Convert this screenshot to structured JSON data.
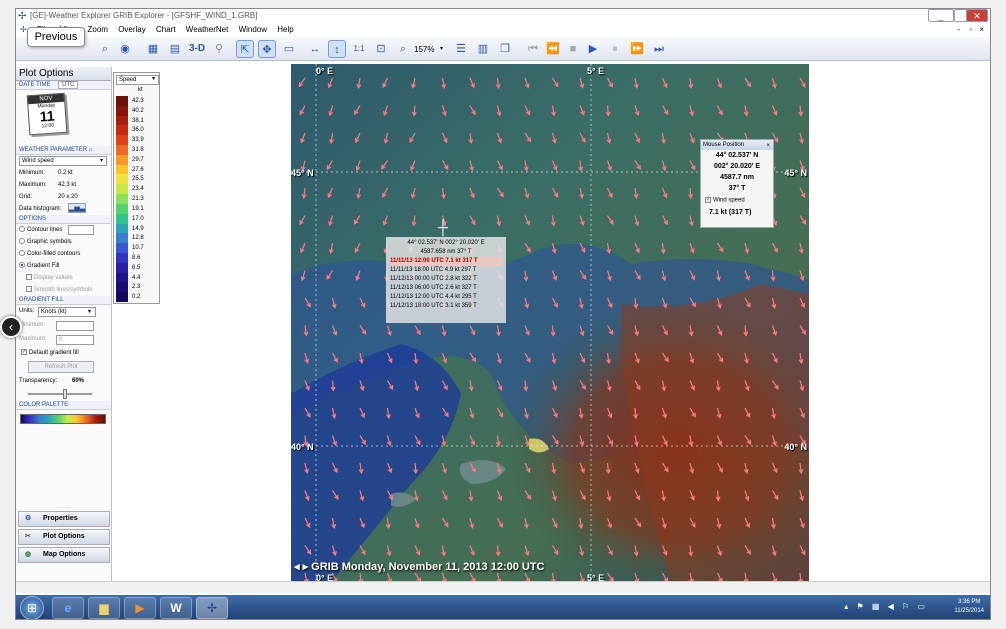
{
  "window": {
    "title": "[GE]-Weather Explorer GRIB Explorer - [GFSHF_WIND_1.GRB]"
  },
  "menu": [
    "File",
    "View",
    "Zoom",
    "Overlay",
    "Chart",
    "WeatherNet",
    "Window",
    "Help"
  ],
  "window_controls": {
    "min": "_",
    "restore": "▫",
    "close": "✕",
    "mdi_min": "-",
    "mdi_restore": "▫",
    "mdi_close": "×"
  },
  "toolbar": {
    "tooltip": "Previous",
    "zoom": "157%",
    "three_d": "3-D"
  },
  "left_panel": {
    "title": "Plot Options",
    "datetime_label": "DATE TIME",
    "utc_label": "UTC",
    "calendar": {
      "month": "NOV",
      "weekday": "Monday",
      "day": "11",
      "time": "12:00"
    },
    "weather_param_label": "WEATHER PARAMETER",
    "param_value": "Wind speed",
    "minimum_label": "Minimum:",
    "minimum": "0.2 kt",
    "maximum_label": "Maximum:",
    "maximum": "42.3 kt",
    "grid_label": "Grid:",
    "grid": "20 x 20",
    "histogram_label": "Data histogram:",
    "options_label": "OPTIONS",
    "options": [
      "Contour lines",
      "Graphic symbols",
      "Color-filled contours",
      "Gradient Fill"
    ],
    "display_values": "Display values",
    "smooth": "Smooth lines/symbols",
    "gradient_label": "GRADIENT FILL",
    "units_label": "Units:",
    "units_value": "Knots (kt)",
    "min_label": "Minimum:",
    "max_label": "Maximum:",
    "max_value": "0",
    "default_fill": "Default gradient fill",
    "refresh": "Refresh Plot",
    "transparency_label": "Transparency:",
    "transparency": "60%",
    "palette_label": "COLOR PALETTE",
    "bottom_buttons": [
      "Properties",
      "Plot Options",
      "Map Options"
    ]
  },
  "legend": {
    "select": "Speed",
    "unit": "kt",
    "values": [
      "42.3",
      "40.2",
      "38.1",
      "36.0",
      "33.9",
      "31.8",
      "29.7",
      "27.6",
      "25.5",
      "23.4",
      "21.3",
      "19.1",
      "17.0",
      "14.9",
      "12.8",
      "10.7",
      "8.6",
      "6.5",
      "4.4",
      "2.3",
      "0.2"
    ],
    "colors": [
      "#6b0f0a",
      "#8a140c",
      "#a81c0e",
      "#c82a10",
      "#e0401a",
      "#ee6a20",
      "#f79a25",
      "#fbc52c",
      "#f2e33a",
      "#c8e84a",
      "#8ee05a",
      "#52d26e",
      "#30c48f",
      "#2aa6b6",
      "#3a7ed0",
      "#3a56d0",
      "#3434c4",
      "#2a20a8",
      "#20148e",
      "#1a0c74",
      "#14085a"
    ]
  },
  "map": {
    "lat_labels": [
      "45° N",
      "40° N"
    ],
    "lon_labels": [
      "0° E",
      "5° E"
    ],
    "grib_label": "GRIB Monday, November 11, 2013 12:00 UTC"
  },
  "tooltip": {
    "rows": [
      "44° 02.537' N   002° 20.020' E",
      "4587.658 nm   37° T",
      "11/11/13 12:00 UTC   7.1 kt   317 T",
      "11/11/13 18:00 UTC   4.9 kt   297 T",
      "11/12/13 00:00 UTC   2.8 kt   322 T",
      "11/12/13 06:00 UTC   2.6 kt   327 T",
      "11/12/13 12:00 UTC   4.4 kt   295 T",
      "11/12/13 18:00 UTC   3.1 kt   359 T"
    ]
  },
  "mouse_position": {
    "title": "Mouse Position",
    "lat": "44° 02.537' N",
    "lon": "002° 20.020' E",
    "dist": "4587.7 nm",
    "bearing": "37° T",
    "wind_label": "Wind speed",
    "wind": "7.1 kt   (317 T)"
  },
  "taskbar": {
    "time": "3:36 PM",
    "date": "11/25/2014"
  }
}
